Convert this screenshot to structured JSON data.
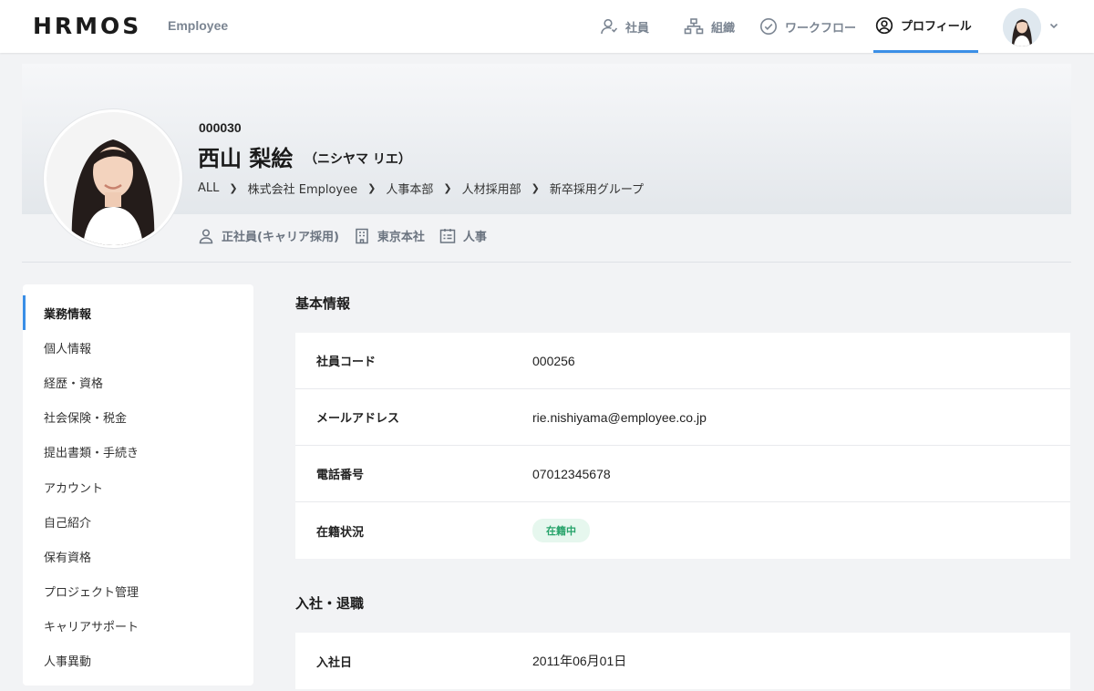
{
  "header": {
    "logo": "HRMOS",
    "logo_sub": "Employee",
    "nav": [
      {
        "label": "社員",
        "icon": "person-icon"
      },
      {
        "label": "組織",
        "icon": "org-chart-icon"
      },
      {
        "label": "ワークフロー",
        "icon": "check-circle-icon"
      },
      {
        "label": "プロフィール",
        "icon": "profile-icon",
        "active": true
      }
    ]
  },
  "profile": {
    "code": "000030",
    "name": "西山 梨絵",
    "kana": "（ニシヤマ リエ）",
    "breadcrumb": [
      "ALL",
      "株式会社 Employee",
      "人事本部",
      "人材採用部",
      "新卒採用グループ"
    ],
    "tags": [
      {
        "label": "正社員(キャリア採用)",
        "icon": "person-outline-icon"
      },
      {
        "label": "東京本社",
        "icon": "building-icon"
      },
      {
        "label": "人事",
        "icon": "id-card-icon"
      }
    ]
  },
  "sidebar": {
    "items": [
      {
        "label": "業務情報",
        "active": true
      },
      {
        "label": "個人情報"
      },
      {
        "label": "経歴・資格"
      },
      {
        "label": "社会保険・税金"
      },
      {
        "label": "提出書類・手続き"
      },
      {
        "label": "アカウント"
      },
      {
        "label": "自己紹介"
      },
      {
        "label": "保有資格"
      },
      {
        "label": "プロジェクト管理"
      },
      {
        "label": "キャリアサポート"
      },
      {
        "label": "人事異動"
      }
    ]
  },
  "basic": {
    "title": "基本情報",
    "rows": [
      {
        "label": "社員コード",
        "value": "000256"
      },
      {
        "label": "メールアドレス",
        "value": "rie.nishiyama@employee.co.jp"
      },
      {
        "label": "電話番号",
        "value": "07012345678"
      },
      {
        "label": "在籍状況",
        "value": "在籍中"
      }
    ]
  },
  "join": {
    "title": "入社・退職",
    "rows": [
      {
        "label": "入社日",
        "value": "2011年06月01日"
      }
    ]
  },
  "colors": {
    "accent": "#3a8ee6",
    "status_bg": "#e6f7ee",
    "status_text": "#26a36a"
  }
}
